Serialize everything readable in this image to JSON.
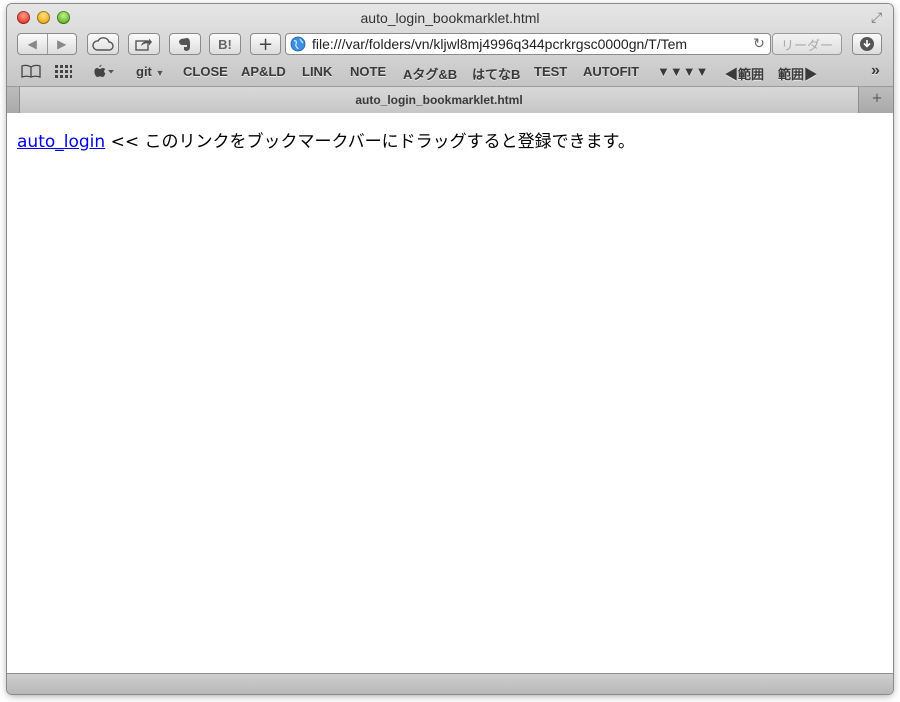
{
  "window": {
    "title": "auto_login_bookmarklet.html"
  },
  "toolbar": {
    "back_icon": "◀",
    "forward_icon": "▶",
    "url": "file:///var/folders/vn/kljwl8mj4996q344pcrkrgsc0000gn/T/Tem",
    "reader_label": "リーダー",
    "hatena_label": "B!",
    "add_label": "+"
  },
  "bookmarks": {
    "items": [
      "git",
      "CLOSE",
      "AP&LD",
      "LINK",
      "NOTE",
      "Aタグ&B",
      "はてなB",
      "TEST",
      "AUTOFIT",
      "▼▼▼▼",
      "◀範囲",
      "範囲▶"
    ],
    "overflow": "»"
  },
  "tab": {
    "title": "auto_login_bookmarklet.html",
    "new_tab_label": "+"
  },
  "content": {
    "link_text": "auto_login",
    "message": " << このリンクをブックマークバーにドラッグすると登録できます。"
  },
  "colors": {
    "link": "#0000ee"
  }
}
